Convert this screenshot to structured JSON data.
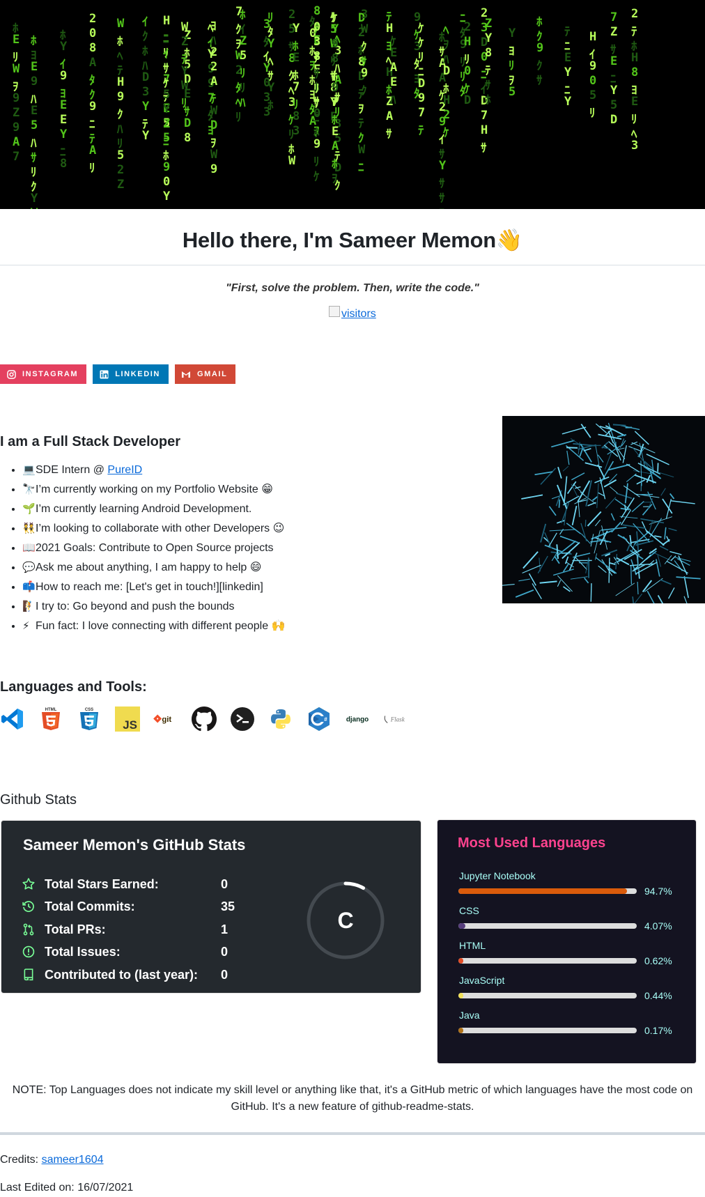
{
  "header": {
    "title": "Hello there, I'm Sameer Memon",
    "wave_emoji": "👋",
    "quote": "\"First, solve the problem. Then, write the code.\"",
    "visitors_alt": "visitors"
  },
  "social": [
    {
      "label": "INSTAGRAM",
      "color": "#e4405f",
      "icon": "instagram-icon"
    },
    {
      "label": "LINKEDIN",
      "color": "#0077b5",
      "icon": "linkedin-icon"
    },
    {
      "label": "GMAIL",
      "color": "#d14836",
      "icon": "gmail-icon"
    }
  ],
  "about": {
    "heading": "I am a Full Stack Developer",
    "items": [
      {
        "emoji": "💻",
        "text": "SDE Intern @ ",
        "link": "PureID"
      },
      {
        "emoji": "🔭",
        "text": "I’m currently working on my Portfolio Website 😁"
      },
      {
        "emoji": "🌱",
        "text": "I’m currently learning Android Development."
      },
      {
        "emoji": "👯",
        "text": "I’m looking to collaborate with other Developers 😉"
      },
      {
        "emoji": "📖",
        "text": "2021 Goals: Contribute to Open Source projects"
      },
      {
        "emoji": "💬",
        "text": "Ask me about anything, I am happy to help 😄"
      },
      {
        "emoji": "📫",
        "text": "How to reach me: [Let's get in touch!][linkedin]"
      },
      {
        "emoji": "🧗",
        "text": "I try to: Go beyond and push the bounds"
      },
      {
        "emoji": "⚡",
        "text": "Fun fact: I love connecting with different people 🙌"
      }
    ]
  },
  "tools": {
    "heading": "Languages and Tools:",
    "items": [
      "vscode-icon",
      "html5-icon",
      "css3-icon",
      "javascript-icon",
      "git-icon",
      "github-icon",
      "terminal-icon",
      "python-icon",
      "csharp-icon",
      "django-icon",
      "flask-icon"
    ],
    "labels": {
      "html": "HTML",
      "css": "CSS",
      "js": "JS",
      "git": "git",
      "django": "django",
      "flask": "Flask"
    }
  },
  "stats": {
    "heading": "Github Stats",
    "card_title": "Sameer Memon's GitHub Stats",
    "rows": [
      {
        "label": "Total Stars Earned:",
        "value": "0",
        "icon": "star-icon"
      },
      {
        "label": "Total Commits:",
        "value": "35",
        "icon": "history-icon"
      },
      {
        "label": "Total PRs:",
        "value": "1",
        "icon": "pull-request-icon"
      },
      {
        "label": "Total Issues:",
        "value": "0",
        "icon": "issue-icon"
      },
      {
        "label": "Contributed to (last year):",
        "value": "0",
        "icon": "repo-icon"
      }
    ],
    "grade": "C",
    "grade_progress": 0.08,
    "accent": "#79ff97"
  },
  "languages": {
    "title": "Most Used Languages",
    "items": [
      {
        "name": "Jupyter Notebook",
        "pct_label": "94.7%",
        "pct": 94.7,
        "color": "#DA5B0B"
      },
      {
        "name": "CSS",
        "pct_label": "4.07%",
        "pct": 4.07,
        "color": "#563d7c"
      },
      {
        "name": "HTML",
        "pct_label": "0.62%",
        "pct": 0.62,
        "color": "#e34c26"
      },
      {
        "name": "JavaScript",
        "pct_label": "0.44%",
        "pct": 0.44,
        "color": "#f1e05a"
      },
      {
        "name": "Java",
        "pct_label": "0.17%",
        "pct": 0.17,
        "color": "#b07219"
      }
    ]
  },
  "footer": {
    "note": "NOTE: Top Languages does not indicate my skill level or anything like that, it's a GitHub metric of which languages have the most code on GitHub. It's a new feature of github-readme-stats.",
    "credits_label": "Credits: ",
    "credits_link": "sameer1604",
    "last_edited": "Last Edited on: 16/07/2021"
  }
}
